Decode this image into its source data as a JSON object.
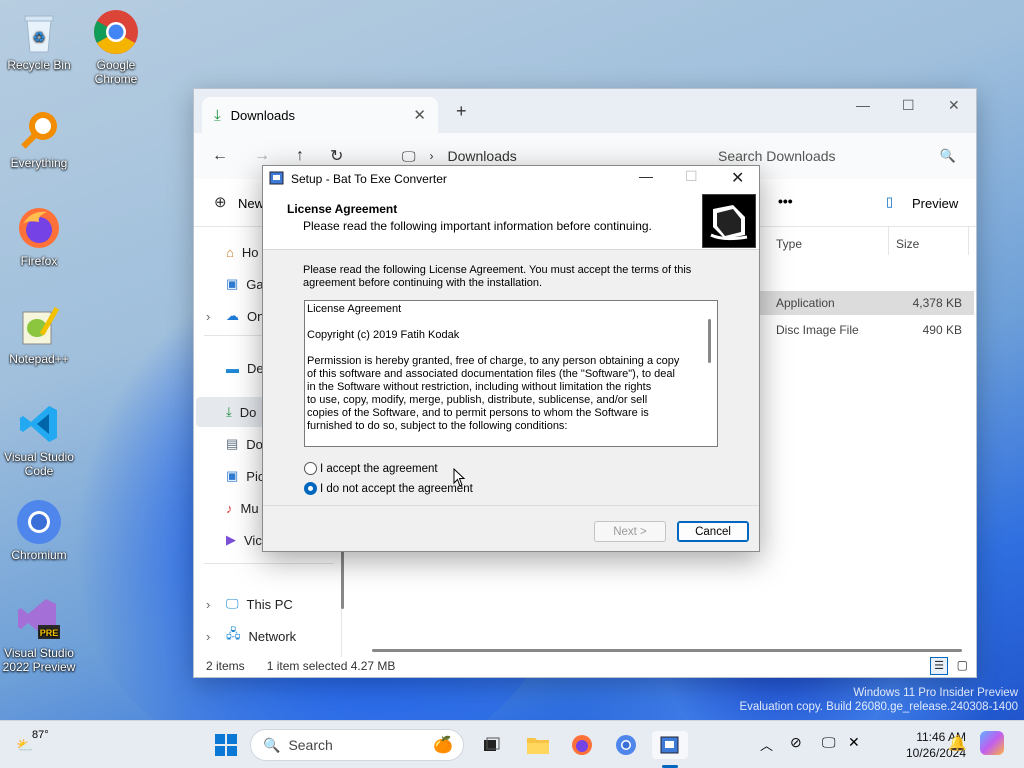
{
  "desktop": {
    "icons": [
      {
        "label": "Recycle Bin"
      },
      {
        "label": "Google Chrome"
      },
      {
        "label": "Everything"
      },
      {
        "label": "Firefox"
      },
      {
        "label": "Notepad++"
      },
      {
        "label": "Visual Studio Code"
      },
      {
        "label": "Chromium"
      },
      {
        "label": "Visual Studio 2022 Preview"
      }
    ],
    "watermark": {
      "line1": "Windows 11 Pro Insider Preview",
      "line2": "Evaluation copy. Build 26080.ge_release.240308-1400"
    }
  },
  "explorer": {
    "tab_title": "Downloads",
    "address": "Downloads",
    "search_placeholder": "Search Downloads",
    "cmd": {
      "new_label": "New",
      "more_label": "•••",
      "preview_label": "Preview"
    },
    "sidebar": {
      "items": [
        {
          "label": "Ho"
        },
        {
          "label": "Ga"
        },
        {
          "label": "On"
        },
        {
          "label": "De"
        },
        {
          "label": "Do"
        },
        {
          "label": "Do"
        },
        {
          "label": "Pic"
        },
        {
          "label": "Mu"
        },
        {
          "label": "Vic"
        },
        {
          "label": "This PC"
        },
        {
          "label": "Network"
        }
      ]
    },
    "columns": {
      "type": "Type",
      "size": "Size"
    },
    "files": [
      {
        "type": "Application",
        "size": "4,378 KB"
      },
      {
        "type": "Disc Image File",
        "size": "490 KB"
      }
    ],
    "status": {
      "count": "2 items",
      "selection": "1 item selected  4.27 MB"
    }
  },
  "dialog": {
    "title": "Setup - Bat To Exe Converter",
    "header_title": "License Agreement",
    "header_subtitle": "Please read the following important information before continuing.",
    "intro": "Please read the following License Agreement. You must accept the terms of this agreement before continuing with the installation.",
    "license_paragraphs": [
      "License Agreement",
      "Copyright (c) 2019 Fatih Kodak",
      "Permission is hereby granted, free of charge, to any person obtaining a copy\nof this software and associated documentation files (the \"Software\"), to deal\nin the Software without restriction, including without limitation the rights\nto use, copy, modify, merge, publish, distribute, sublicense, and/or sell\ncopies of the Software, and to permit persons to whom the Software is\nfurnished to do so, subject to the following conditions:"
    ],
    "accept_label": "I accept the agreement",
    "decline_label": "I do not accept the agreement",
    "selected_option": "decline",
    "next_label": "Next >",
    "cancel_label": "Cancel"
  },
  "taskbar": {
    "weather": "87°",
    "search_label": "Search",
    "time": "11:46 AM",
    "date": "10/26/2024"
  },
  "colors": {
    "accent": "#0067c0",
    "taskbar": "#e7ecf3"
  }
}
